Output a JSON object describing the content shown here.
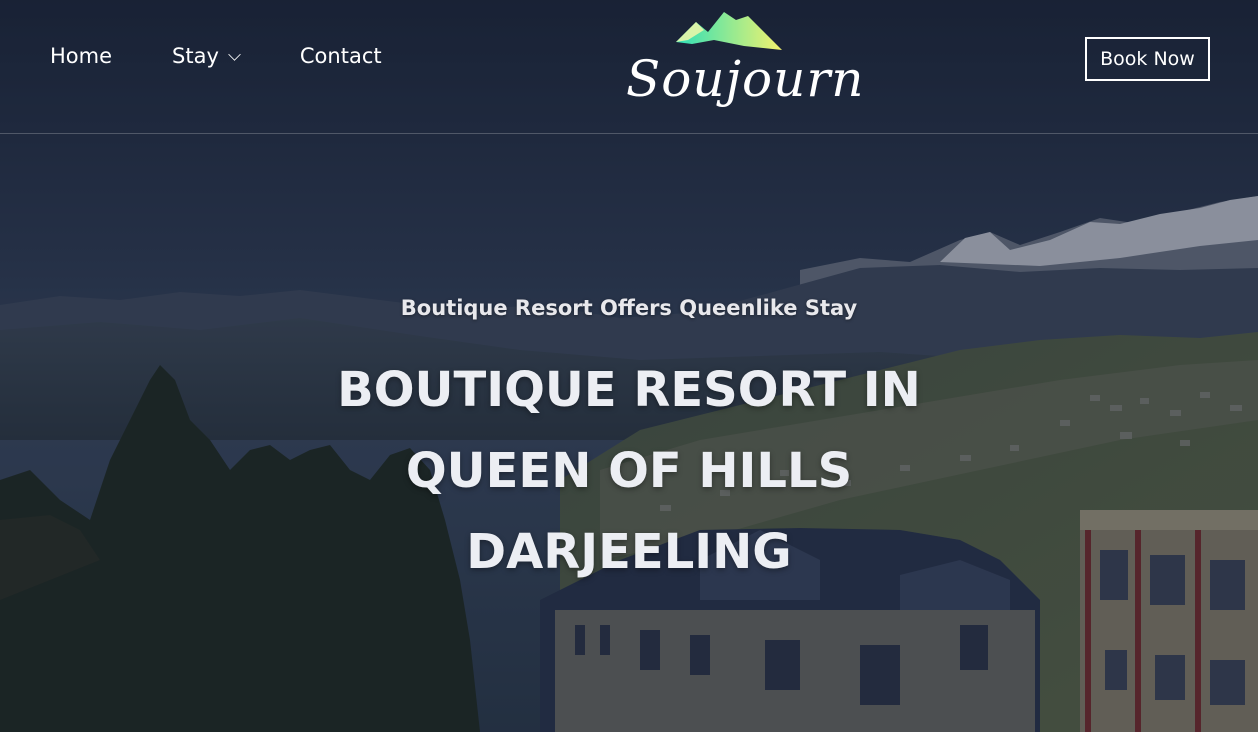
{
  "header": {
    "nav": {
      "home": "Home",
      "stay": "Stay",
      "contact": "Contact"
    },
    "logo": {
      "text": "Soujourn",
      "icon": "mountain-icon"
    },
    "book_button": "Book Now"
  },
  "hero": {
    "subtitle": "Boutique Resort Offers Queenlike Stay",
    "title_lines": [
      "BOUTIQUE RESORT IN",
      "QUEEN OF HILLS",
      "DARJEELING"
    ]
  },
  "colors": {
    "logo_gradient_start": "#2ee0b8",
    "logo_gradient_end": "#f3f26e",
    "header_bg": "#1c2538"
  }
}
